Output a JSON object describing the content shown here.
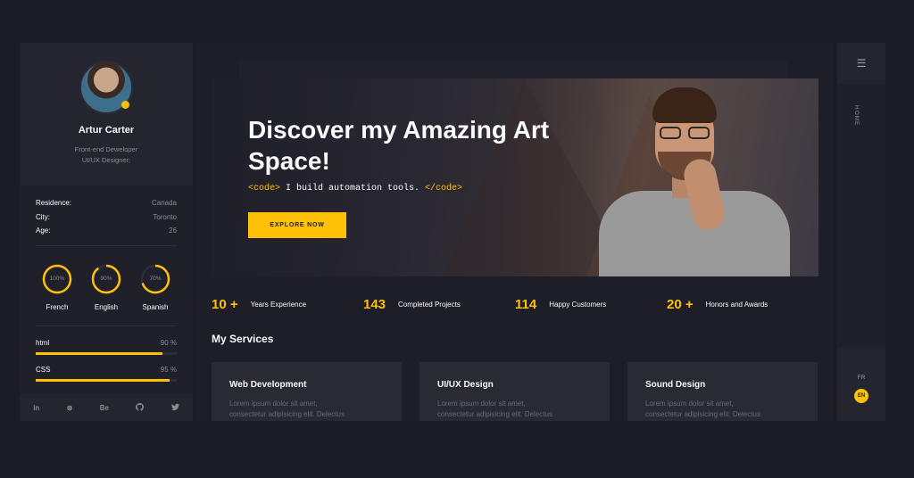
{
  "profile": {
    "name": "Artur Carter",
    "role_line1": "Front-end Deweloper",
    "role_line2": "UI/UX Designer;"
  },
  "info": [
    {
      "key": "Residence:",
      "value": "Canada"
    },
    {
      "key": "City:",
      "value": "Toronto"
    },
    {
      "key": "Age:",
      "value": "26"
    }
  ],
  "languages": [
    {
      "name": "French",
      "percent_label": "100%",
      "level": 1.0
    },
    {
      "name": "English",
      "percent_label": "90%",
      "level": 0.9
    },
    {
      "name": "Spanish",
      "percent_label": "70%",
      "level": 0.7
    }
  ],
  "skills": [
    {
      "name": "html",
      "percent_label": "90 %",
      "level": 0.9
    },
    {
      "name": "CSS",
      "percent_label": "95 %",
      "level": 0.95
    }
  ],
  "socials": [
    "in",
    "⊛",
    "Be",
    "gh",
    "tw"
  ],
  "hero": {
    "title": "Discover my Amazing Art Space!",
    "code_open": "<code>",
    "code_text": " I build automation tools. ",
    "code_close": "</code>",
    "button": "EXPLORE NOW"
  },
  "stats": [
    {
      "number": "10 +",
      "label": "Years Experience"
    },
    {
      "number": "143",
      "label": "Completed Projects"
    },
    {
      "number": "114",
      "label": "Happy Customers"
    },
    {
      "number": "20 +",
      "label": "Honors and Awards"
    }
  ],
  "services": {
    "title": "My Services",
    "cards": [
      {
        "title": "Web Development",
        "desc1": "Lorem ipsum dolor sit amet,",
        "desc2": "consectetur adipisicing elit. Delectus"
      },
      {
        "title": "UI/UX Design",
        "desc1": "Lorem ipsum dolor sit amet,",
        "desc2": "consectetur adipisicing elit. Delectus"
      },
      {
        "title": "Sound Design",
        "desc1": "Lorem ipsum dolor sit amet,",
        "desc2": "consectetur adipisicing elit. Delectus"
      }
    ]
  },
  "rightbar": {
    "menu_icon": "☰",
    "home_label": "HOME",
    "lang_fr": "FR",
    "lang_en": "EN"
  },
  "colors": {
    "accent": "#ffc107",
    "bg": "#1c1c25",
    "panel": "#20202a"
  }
}
